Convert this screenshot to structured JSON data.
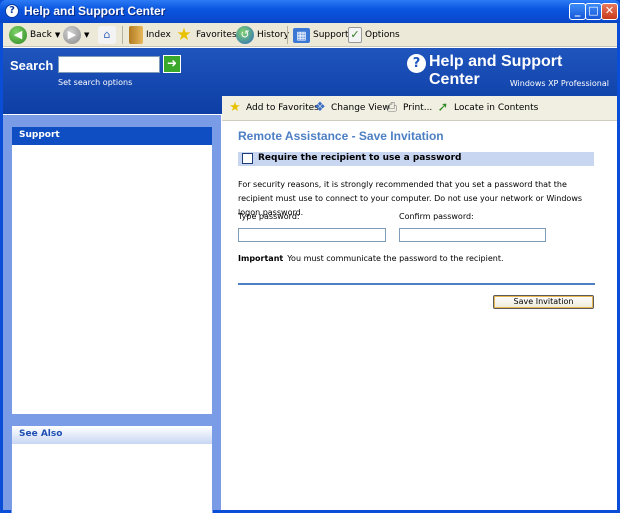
{
  "window": {
    "title": "Help and Support Center",
    "min": "_",
    "max": "□",
    "close": "✕"
  },
  "toolbar": {
    "back": "Back",
    "index": "Index",
    "favorites": "Favorites",
    "history": "History",
    "support": "Support",
    "options": "Options"
  },
  "header": {
    "search_label": "Search",
    "search_value": "",
    "search_options": "Set search options",
    "title": "Help and Support Center",
    "subtitle": "Windows XP Professional"
  },
  "leftpane": {
    "support_title": "Support",
    "see_also_title": "See Also"
  },
  "content_toolbar": {
    "add_favorites": "Add to Favorites",
    "change_view": "Change View",
    "print": "Print...",
    "locate": "Locate in Contents"
  },
  "content": {
    "title": "Remote Assistance - Save Invitation",
    "require_password": "Require the recipient to use a password",
    "require_password_checked": false,
    "paragraph": "For security reasons, it is strongly recommended that you set a password that the recipient must use to connect to your computer. Do not use your network or Windows logon password.",
    "type_password_label": "Type password:",
    "confirm_password_label": "Confirm password:",
    "important_label": "Important",
    "important_text": "You must communicate the password to the recipient.",
    "save_button": "Save Invitation"
  },
  "colors": {
    "accent": "#0d3ea5",
    "title_blue": "#4d7fc4",
    "band": "#c9d6f1"
  }
}
